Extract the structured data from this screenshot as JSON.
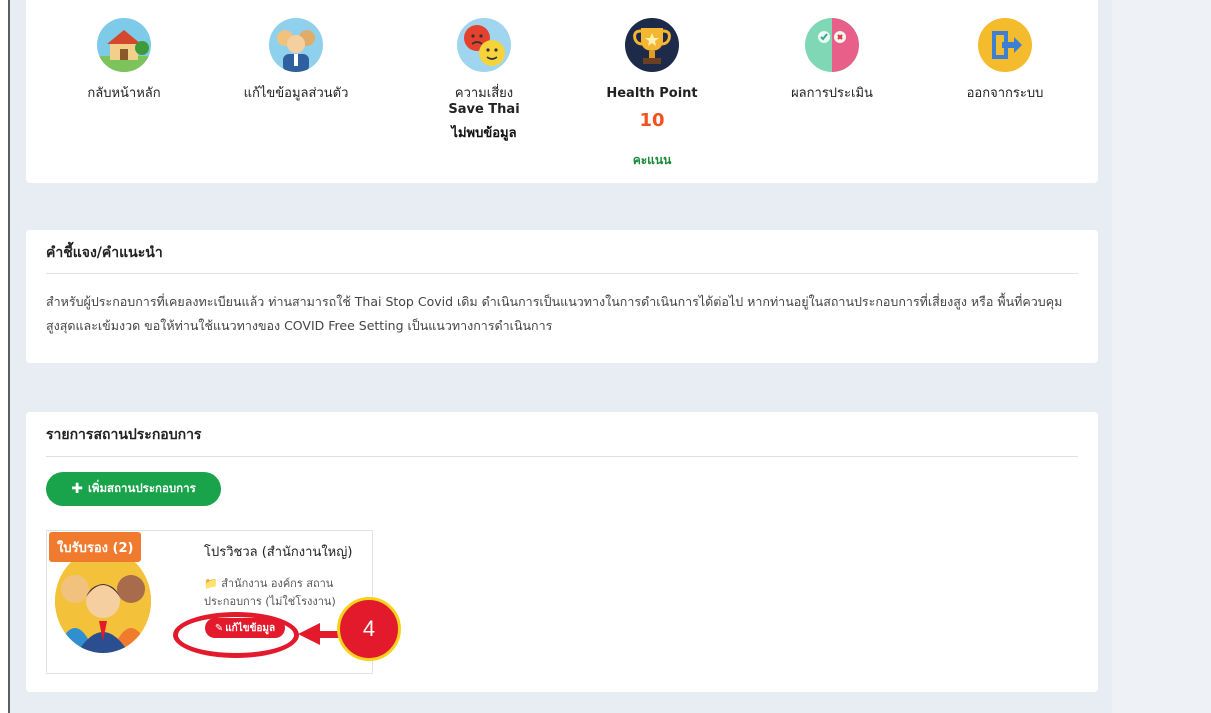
{
  "menu": [
    {
      "label": "กลับหน้าหลัก",
      "icon": "home-icon"
    },
    {
      "label": "แก้ไขข้อมูลส่วนตัว",
      "icon": "profile-edit-icon"
    },
    {
      "label": "ความเสี่ยง",
      "sub": "Save Thai",
      "status": "ไม่พบข้อมูล",
      "icon": "risk-faces-icon"
    },
    {
      "label": "Health Point",
      "value": "10",
      "unit": "คะแนน",
      "icon": "trophy-icon"
    },
    {
      "label": "ผลการประเมิน",
      "icon": "assessment-icon"
    },
    {
      "label": "ออกจากระบบ",
      "icon": "logout-icon"
    }
  ],
  "notice": {
    "title": "คำชี้แจง/คำแนะนำ",
    "text": "สำหรับผู้ประกอบการที่เคยลงทะเบียนแล้ว ท่านสามารถใช้ Thai Stop Covid เดิม ดำเนินการเป็นแนวทางในการดำเนินการได้ต่อไป หากท่านอยู่ในสถานประกอบการที่เสี่ยงสูง หรือ พื้นที่ควบคุมสูงสุดและเข้มงวด ขอให้ท่านใช้แนวทางของ COVID Free Setting เป็นแนวทางการดำเนินการ"
  },
  "business": {
    "title": "รายการสถานประกอบการ",
    "add_label": "เพิ่มสถานประกอบการ",
    "items": [
      {
        "badge": "ใบรับรอง (2)",
        "name": "โปรวิชวล (สำนักงานใหญ่)",
        "type": "สำนักงาน องค์กร สถานประกอบการ (ไม่ใช่โรงงาน)",
        "edit_label": "แก้ไขข้อมูล"
      }
    ]
  },
  "annotation": {
    "step": "4"
  },
  "colors": {
    "accent_green": "#19a34a",
    "accent_red": "#e21a2c",
    "badge_orange": "#f07b2e",
    "points_orange": "#f4511e"
  }
}
